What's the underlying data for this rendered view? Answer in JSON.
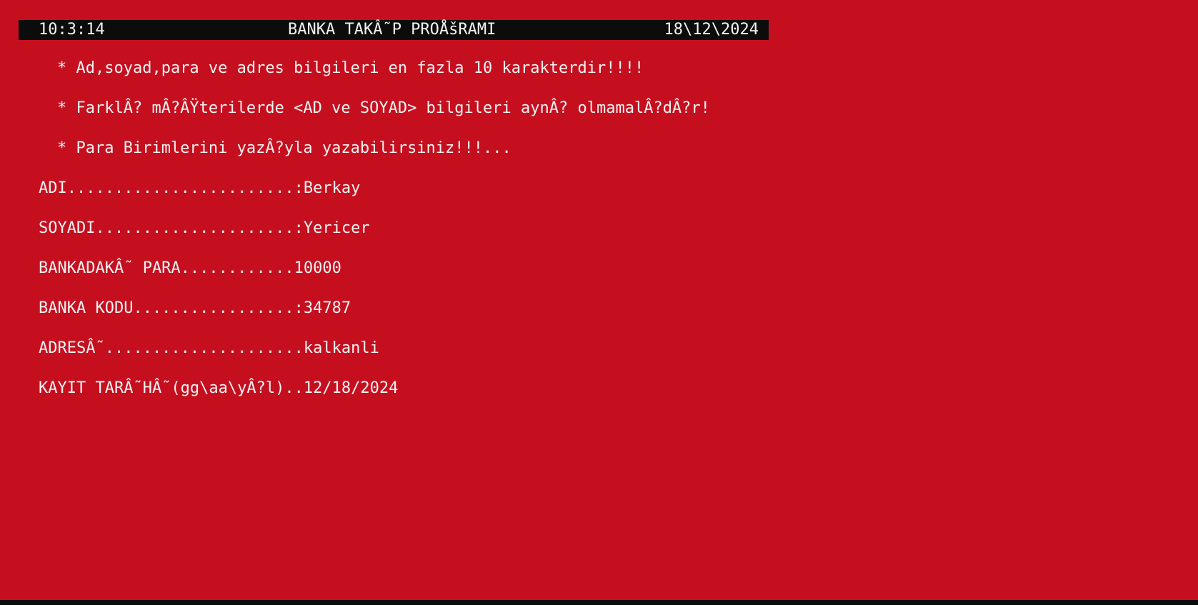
{
  "header": {
    "time": "10:3:14",
    "title": "BANKA TAKÂ˜P PROÅšRAMI",
    "date": "18\\12\\2024"
  },
  "notes": [
    "* Ad,soyad,para ve adres bilgileri en fazla 10 karakterdir!!!!",
    "* FarklÂ? mÂ?ÂŸterilerde <AD ve SOYAD> bilgileri aynÂ? olmamalÂ?dÂ?r!",
    "* Para Birimlerini yazÂ?yla yazabilirsiniz!!!..."
  ],
  "fields": [
    {
      "label": "ADI........................:",
      "value": "Berkay"
    },
    {
      "label": "SOYADI.....................:",
      "value": "Yericer"
    },
    {
      "label": "BANKADAKÂ˜ PARA............",
      "value": "10000"
    },
    {
      "label": "BANKA KODU.................:",
      "value": "34787"
    },
    {
      "label": "ADRESÂ˜.....................",
      "value": "kalkanli"
    },
    {
      "label": "KAYIT TARÂ˜HÂ˜(gg\\aa\\yÂ?l)..",
      "value": "12/18/2024"
    }
  ],
  "colors": {
    "background": "#c50f1f",
    "text": "#f2f2f2",
    "header_bar": "#0c0c0c"
  }
}
